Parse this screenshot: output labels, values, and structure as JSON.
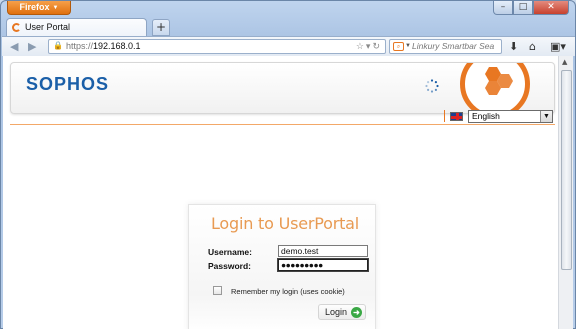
{
  "browser": {
    "app_button": "Firefox",
    "tab_title": "User Portal",
    "new_tab_symbol": "+",
    "url_protocol": "https://",
    "url_host": "192.168.0.1",
    "search_placeholder": "Linkury Smartbar Sea"
  },
  "header": {
    "logo_text": "SOPHOS",
    "brand_color": "#1b5fa8",
    "accent_color": "#e87722"
  },
  "language": {
    "selected": "English"
  },
  "login": {
    "title": "Login to UserPortal",
    "username_label": "Username:",
    "username_value": "demo.test",
    "password_label": "Password:",
    "password_value": "●●●●●●●●●",
    "remember_label": "Remember my login (uses cookie)",
    "remember_checked": false,
    "submit_label": "Login"
  },
  "icons": [
    "back-arrow-icon",
    "forward-arrow-icon",
    "lock-icon",
    "star-icon",
    "reload-icon",
    "download-icon",
    "home-icon",
    "menu-icon",
    "loading-spinner-icon",
    "uk-flag-icon",
    "go-arrow-icon"
  ]
}
